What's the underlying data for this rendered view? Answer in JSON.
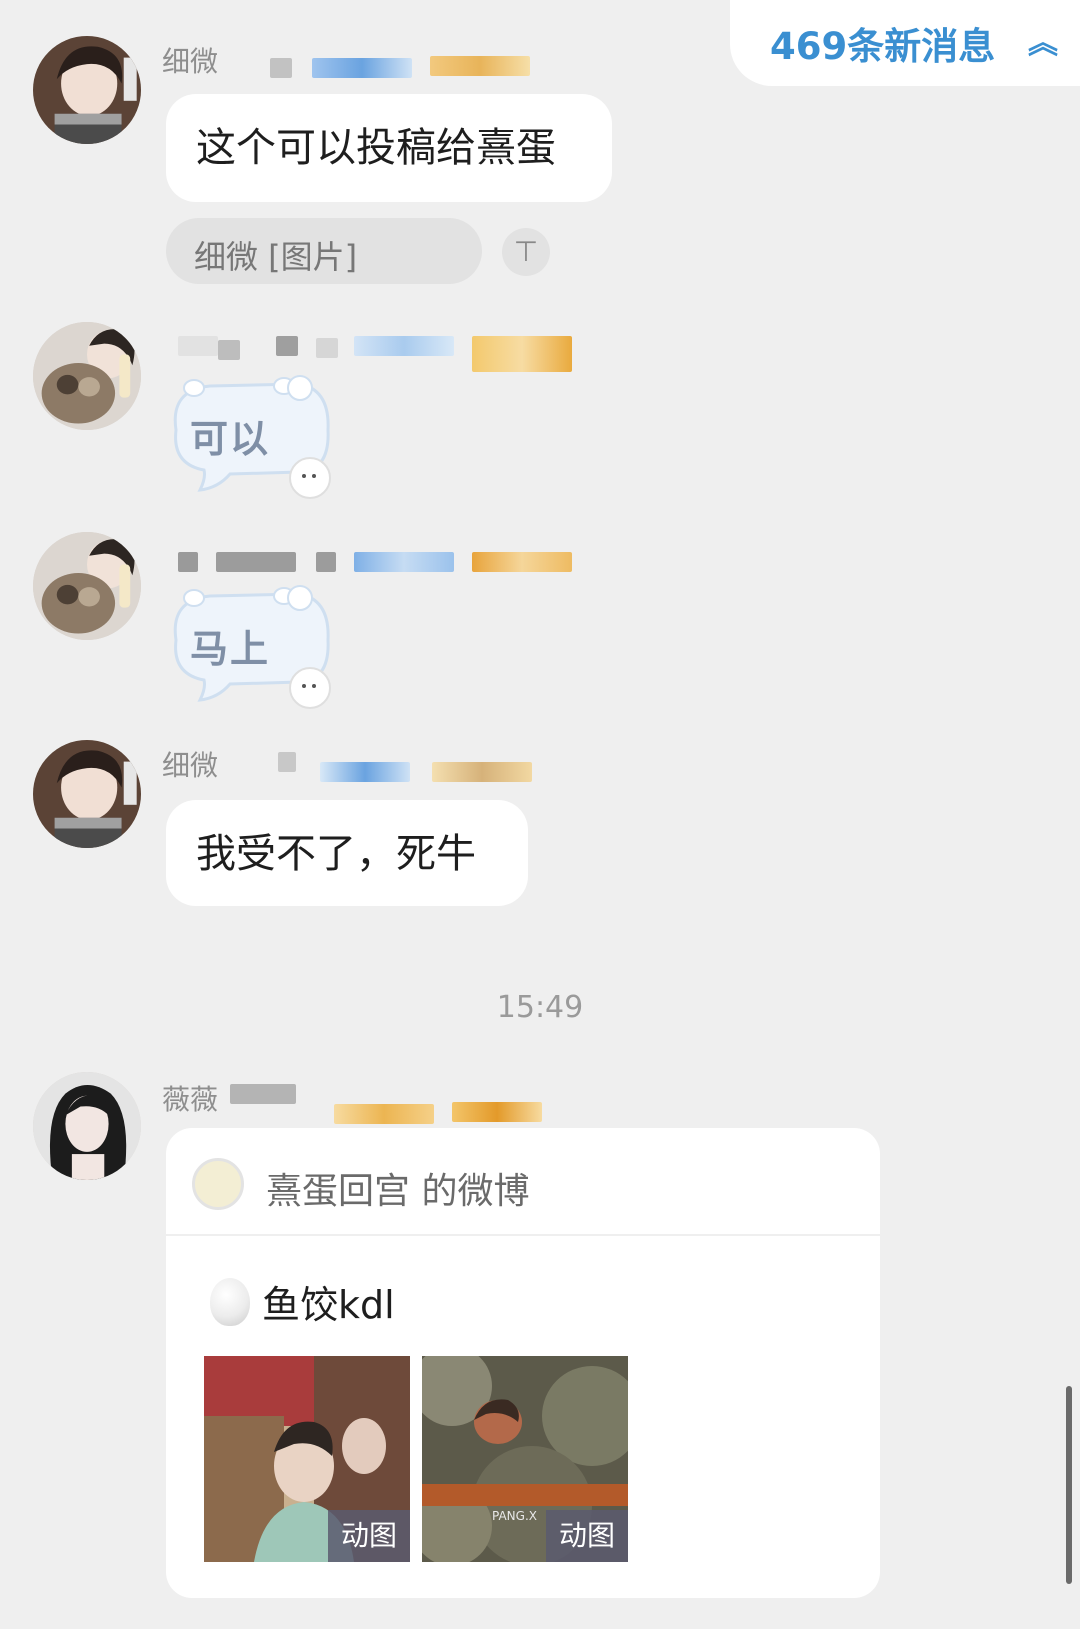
{
  "new_messages": {
    "label": "469条新消息",
    "icon": "chevron-double-up-icon"
  },
  "messages": [
    {
      "sender": "细微",
      "text": "这个可以投稿给熹蛋",
      "quote": "细微 [图片]",
      "quote_icon": "pin-top-icon"
    },
    {
      "sender": "",
      "sticker_text": "可以"
    },
    {
      "sender": "",
      "sticker_text": "马上"
    },
    {
      "sender": "细微",
      "text": "我受不了，死牛"
    }
  ],
  "timestamp": "15:49",
  "shared_post": {
    "sender": "薇薇",
    "source": "熹蛋回宫 的微博",
    "title": "鱼饺kdl",
    "image_tags": [
      "动图",
      "动图"
    ],
    "watermark": "PANG.X"
  },
  "colors": {
    "background": "#efefef",
    "accent": "#3a8fd1",
    "bubble": "#ffffff"
  }
}
